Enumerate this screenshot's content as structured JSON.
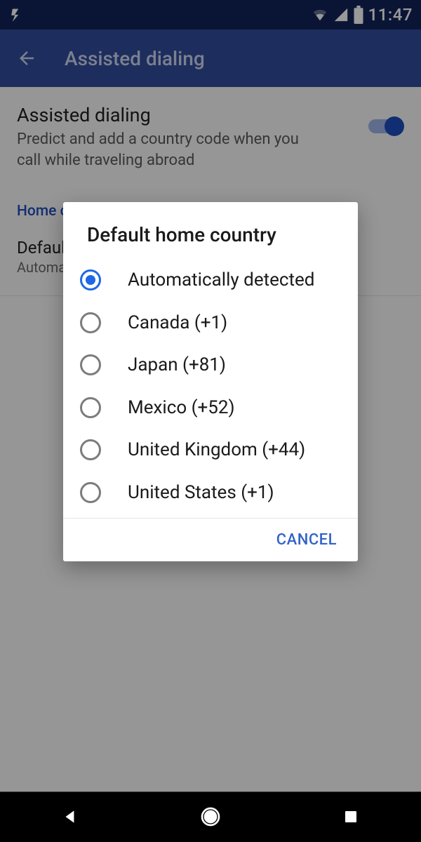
{
  "statusBar": {
    "clock": "11:47"
  },
  "appBar": {
    "title": "Assisted dialing"
  },
  "setting": {
    "title": "Assisted dialing",
    "subtitle": "Predict and add a country code when you call while traveling abroad"
  },
  "section": {
    "header": "Home country"
  },
  "pref": {
    "title": "Default home country",
    "subtitle": "Automatically detected"
  },
  "dialog": {
    "title": "Default home country",
    "options": [
      {
        "label": "Automatically detected",
        "selected": true
      },
      {
        "label": "Canada (+1)",
        "selected": false
      },
      {
        "label": "Japan (+81)",
        "selected": false
      },
      {
        "label": "Mexico (+52)",
        "selected": false
      },
      {
        "label": "United Kingdom (+44)",
        "selected": false
      },
      {
        "label": "United States (+1)",
        "selected": false
      }
    ],
    "cancelLabel": "CANCEL"
  }
}
